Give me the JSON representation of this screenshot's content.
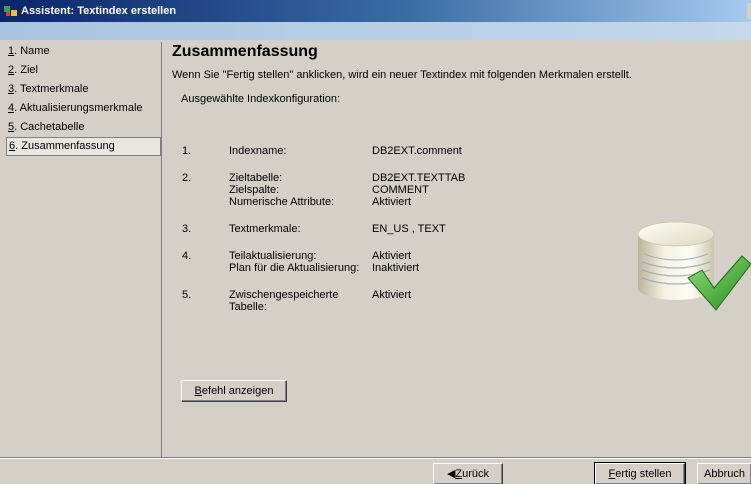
{
  "window": {
    "title": "Assistent: Textindex erstellen"
  },
  "nav": {
    "items": [
      {
        "num": "1",
        "label": ". Name"
      },
      {
        "num": "2",
        "label": ". Ziel"
      },
      {
        "num": "3",
        "label": ". Textmerkmale"
      },
      {
        "num": "4",
        "label": ". Aktualisierungsmerkmale"
      },
      {
        "num": "5",
        "label": ". Cachetabelle"
      },
      {
        "num": "6",
        "label": ". Zusammenfassung"
      }
    ],
    "active_index": 5
  },
  "main": {
    "title": "Zusammenfassung",
    "intro": "Wenn Sie \"Fertig stellen\" anklicken, wird ein neuer Textindex mit folgenden Merkmalen erstellt.",
    "section_label": "Ausgewählte Indexkonfiguration:",
    "summary": [
      {
        "num": "1.",
        "lines": [
          {
            "label": "Indexname:",
            "value": "DB2EXT.comment"
          }
        ]
      },
      {
        "num": "2.",
        "lines": [
          {
            "label": "Zieltabelle:",
            "value": "DB2EXT.TEXTTAB"
          },
          {
            "label": "Zielspalte:",
            "value": "COMMENT"
          },
          {
            "label": "Numerische Attribute:",
            "value": "Aktiviert"
          }
        ]
      },
      {
        "num": "3.",
        "lines": [
          {
            "label": "Textmerkmale:",
            "value": "EN_US , TEXT"
          }
        ]
      },
      {
        "num": "4.",
        "lines": [
          {
            "label": "Teilaktualisierung:",
            "value": "Aktiviert"
          },
          {
            "label": "Plan für die Aktualisierung:",
            "value": "Inaktiviert"
          }
        ]
      },
      {
        "num": "5.",
        "lines": [
          {
            "label": "Zwischengespeicherte",
            "value": "Aktiviert"
          },
          {
            "label": "Tabelle:",
            "value": ""
          }
        ]
      }
    ],
    "show_command": {
      "accel": "B",
      "rest": "efehl anzeigen"
    }
  },
  "footer": {
    "back": {
      "arrow": "◀",
      "accel": "Z",
      "rest": "urück"
    },
    "finish": {
      "accel": "F",
      "rest": "ertig stellen"
    },
    "cancel": {
      "label": "Abbruch"
    }
  },
  "colors": {
    "titlebar_start": "#0a246a",
    "checkmark": "#3aa12a",
    "dialog_bg": "#d4d0c8"
  }
}
